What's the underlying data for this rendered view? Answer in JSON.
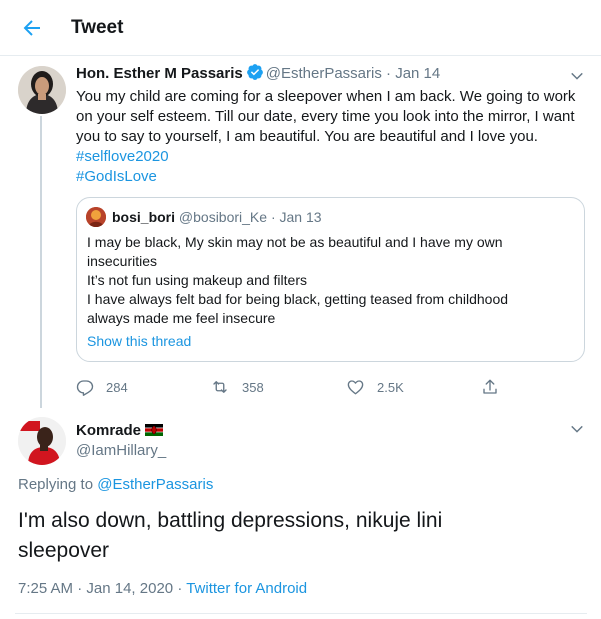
{
  "header": {
    "title": "Tweet"
  },
  "tweet": {
    "author_name": "Hon. Esther M Passaris",
    "author_handle": "@EstherPassaris",
    "separator": "·",
    "date": "Jan 14",
    "text_lines": [
      "You my child are coming for a sleepover when I am back. We going to work",
      "on your self esteem. Till our date, every time you look into the mirror, I  want",
      "you to say to yourself, I am beautiful. You are beautiful and I love you."
    ],
    "hashtags": [
      "#selflove2020",
      "#GodIsLove"
    ],
    "quoted": {
      "author_name": "bosi_bori",
      "author_handle": "@bosibori_Ke",
      "separator": "·",
      "date": "Jan 13",
      "lines": [
        "I may be black, My skin may not be as beautiful and I have my own",
        "insecurities",
        "It’s not fun using makeup and filters",
        "I have always felt bad for being black, getting teased from childhood",
        "always made me feel insecure"
      ],
      "show_thread": "Show this thread"
    },
    "actions": {
      "replies": "284",
      "retweets": "358",
      "likes": "2.5K"
    }
  },
  "reply": {
    "author_name": "Komrade",
    "author_handle": "@IamHillary_",
    "replying_to_prefix": "Replying to",
    "replying_to_handle": "@EstherPassaris",
    "text_lines": [
      "I'm also down, battling depressions, nikuje lini",
      "sleepover"
    ],
    "time": "7:25 AM",
    "separator": "·",
    "date": "Jan 14, 2020",
    "source_sep": "·",
    "source": "Twitter for Android"
  },
  "icons": {
    "back": "arrow-left-icon",
    "verified": "verified-badge-icon",
    "caret": "chevron-down-icon",
    "reply": "reply-icon",
    "retweet": "retweet-icon",
    "like": "heart-icon",
    "share": "share-icon",
    "flag": "kenya-flag-icon"
  },
  "colors": {
    "accent": "#1da1f2",
    "link": "#1b95e0",
    "muted": "#657786",
    "text": "#14171a"
  }
}
